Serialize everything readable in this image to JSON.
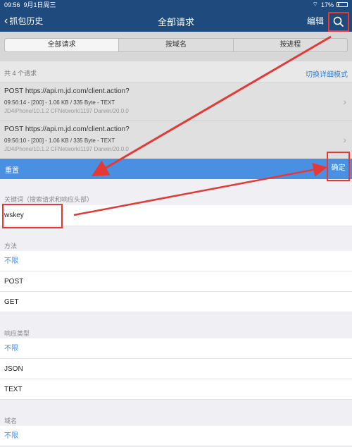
{
  "statusbar": {
    "time": "09:56",
    "date": "9月1日周三",
    "battery": "17%"
  },
  "navbar": {
    "back_label": "抓包历史",
    "title": "全部请求",
    "edit_label": "编辑"
  },
  "segments": [
    "全部请求",
    "按域名",
    "按进程"
  ],
  "list": {
    "count_text": "共 4 个请求",
    "mode_toggle": "切换详细模式",
    "requests": [
      {
        "title": "POST https://api.m.jd.com/client.action?",
        "meta": "09:56:14 - [200] - 1.06 KB / 335 Byte - TEXT",
        "ua": "JD4iPhone/10.1.2 CFNetwork/1197 Darwin/20.0.0"
      },
      {
        "title": "POST https://api.m.jd.com/client.action?",
        "meta": "09:56:10 - [200] - 1.06 KB / 335 Byte - TEXT",
        "ua": "JD4iPhone/10.1.2 CFNetwork/1197 Darwin/20.0.0"
      }
    ]
  },
  "filter_bar": {
    "reset_label": "重置",
    "confirm_label": "确定"
  },
  "keyword": {
    "label": "关键词（搜索请求和响应头部）",
    "value": "wskey"
  },
  "method": {
    "label": "方法",
    "options": [
      "不限",
      "POST",
      "GET"
    ]
  },
  "response_type": {
    "label": "响应类型",
    "options": [
      "不限",
      "JSON",
      "TEXT"
    ]
  },
  "domain": {
    "label": "域名",
    "options": [
      "不限"
    ]
  },
  "colors": {
    "nav": "#1f4a7e",
    "accent": "#4a90e2",
    "annotation": "#e53935"
  },
  "icons": [
    "chevron-left-icon",
    "search-icon",
    "wifi-icon",
    "battery-icon",
    "chevron-right-icon"
  ]
}
